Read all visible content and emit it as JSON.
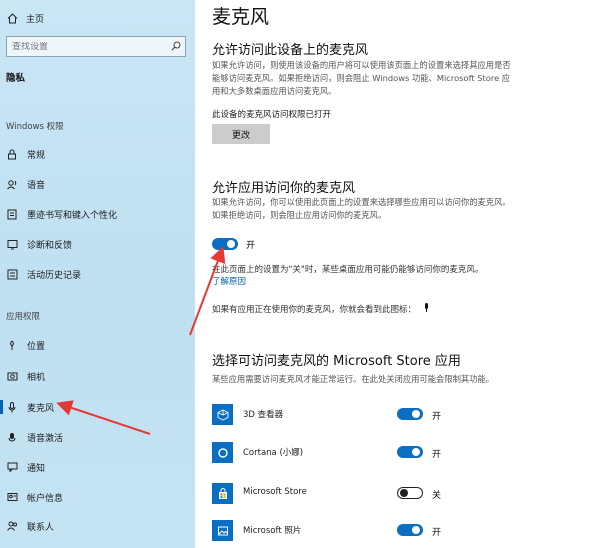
{
  "sidebar": {
    "home_label": "主页",
    "search_placeholder": "查找设置",
    "section_title": "隐私",
    "windows_section": "Windows 权限",
    "windows_items": [
      {
        "label": "常规",
        "icon": "lock-icon"
      },
      {
        "label": "语音",
        "icon": "speech-icon"
      },
      {
        "label": "墨迹书写和键入个性化",
        "icon": "pen-icon"
      },
      {
        "label": "诊断和反馈",
        "icon": "diagnostics-icon"
      },
      {
        "label": "活动历史记录",
        "icon": "history-icon"
      }
    ],
    "apps_section": "应用权限",
    "app_items": [
      {
        "label": "位置",
        "icon": "location-icon"
      },
      {
        "label": "相机",
        "icon": "camera-icon"
      },
      {
        "label": "麦克风",
        "icon": "microphone-icon"
      },
      {
        "label": "语音激活",
        "icon": "voice-activation-icon"
      },
      {
        "label": "通知",
        "icon": "notification-icon"
      },
      {
        "label": "帐户信息",
        "icon": "account-icon"
      },
      {
        "label": "联系人",
        "icon": "contacts-icon"
      }
    ]
  },
  "main": {
    "title": "麦克风",
    "device_heading": "允许访问此设备上的麦克风",
    "device_desc": "如果允许访问，则使用该设备的用户将可以使用该页面上的设置来选择其应用是否能够访问麦克风。如果拒绝访问，则会阻止 Windows 功能、Microsoft Store 应用和大多数桌面应用访问麦克风。",
    "device_status": "此设备的麦克风访问权限已打开",
    "change_button": "更改",
    "apps_heading": "允许应用访问你的麦克风",
    "apps_desc": "如果允许访问，你可以使用此页面上的设置来选择哪些应用可以访问你的麦克风。如果拒绝访问，则会阻止应用访问你的麦克风。",
    "apps_toggle_label": "开",
    "apps_toggle_on": true,
    "note": "在此页面上的设置为\"关\"时，某些桌面应用可能仍能够访问你的麦克风。",
    "learn_link": "了解原因",
    "in_use_note": "如果有应用正在使用你的麦克风，你就会看到此图标：",
    "store_heading": "选择可访问麦克风的 Microsoft Store 应用",
    "store_desc": "某些应用需要访问麦克风才能正常运行。在此处关闭应用可能会限制其功能。",
    "apps": [
      {
        "name": "3D 查看器",
        "state": "开",
        "on": true,
        "icon": "cube-icon"
      },
      {
        "name": "Cortana (小娜)",
        "state": "开",
        "on": true,
        "icon": "cortana-icon"
      },
      {
        "name": "Microsoft Store",
        "state": "关",
        "on": false,
        "icon": "store-icon"
      },
      {
        "name": "Microsoft 照片",
        "state": "开",
        "on": true,
        "icon": "photos-icon"
      }
    ]
  },
  "colors": {
    "accent": "#0a6fc2",
    "annotation": "#e53935"
  }
}
